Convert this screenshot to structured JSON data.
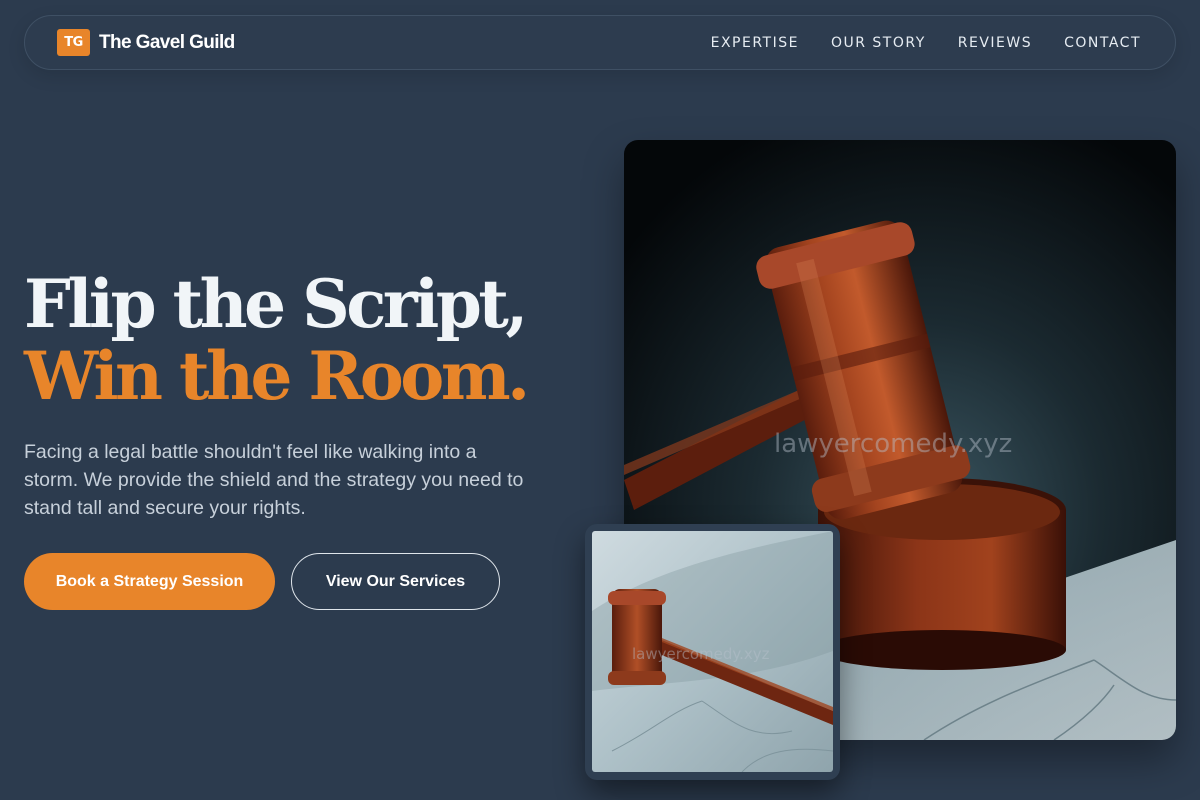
{
  "nav": {
    "logo_initials": "TG",
    "brand": "The Gavel Guild",
    "links": [
      "EXPERTISE",
      "OUR STORY",
      "REVIEWS",
      "CONTACT"
    ]
  },
  "hero": {
    "title_line1": "Flip the Script,",
    "title_line2": "Win the Room.",
    "description": "Facing a legal battle shouldn't feel like walking into a storm. We provide the shield and the strategy you need to stand tall and secure your rights.",
    "primary_button": "Book a Strategy Session",
    "secondary_button": "View Our Services"
  },
  "images": {
    "main_alt": "Wooden judge gavel on sound block",
    "small_alt": "Wooden gavel lying on marble surface",
    "watermark": "lawyercomedy.xyz"
  },
  "colors": {
    "background": "#2c3b4e",
    "accent": "#e8852a",
    "text": "#f1f5f8"
  }
}
